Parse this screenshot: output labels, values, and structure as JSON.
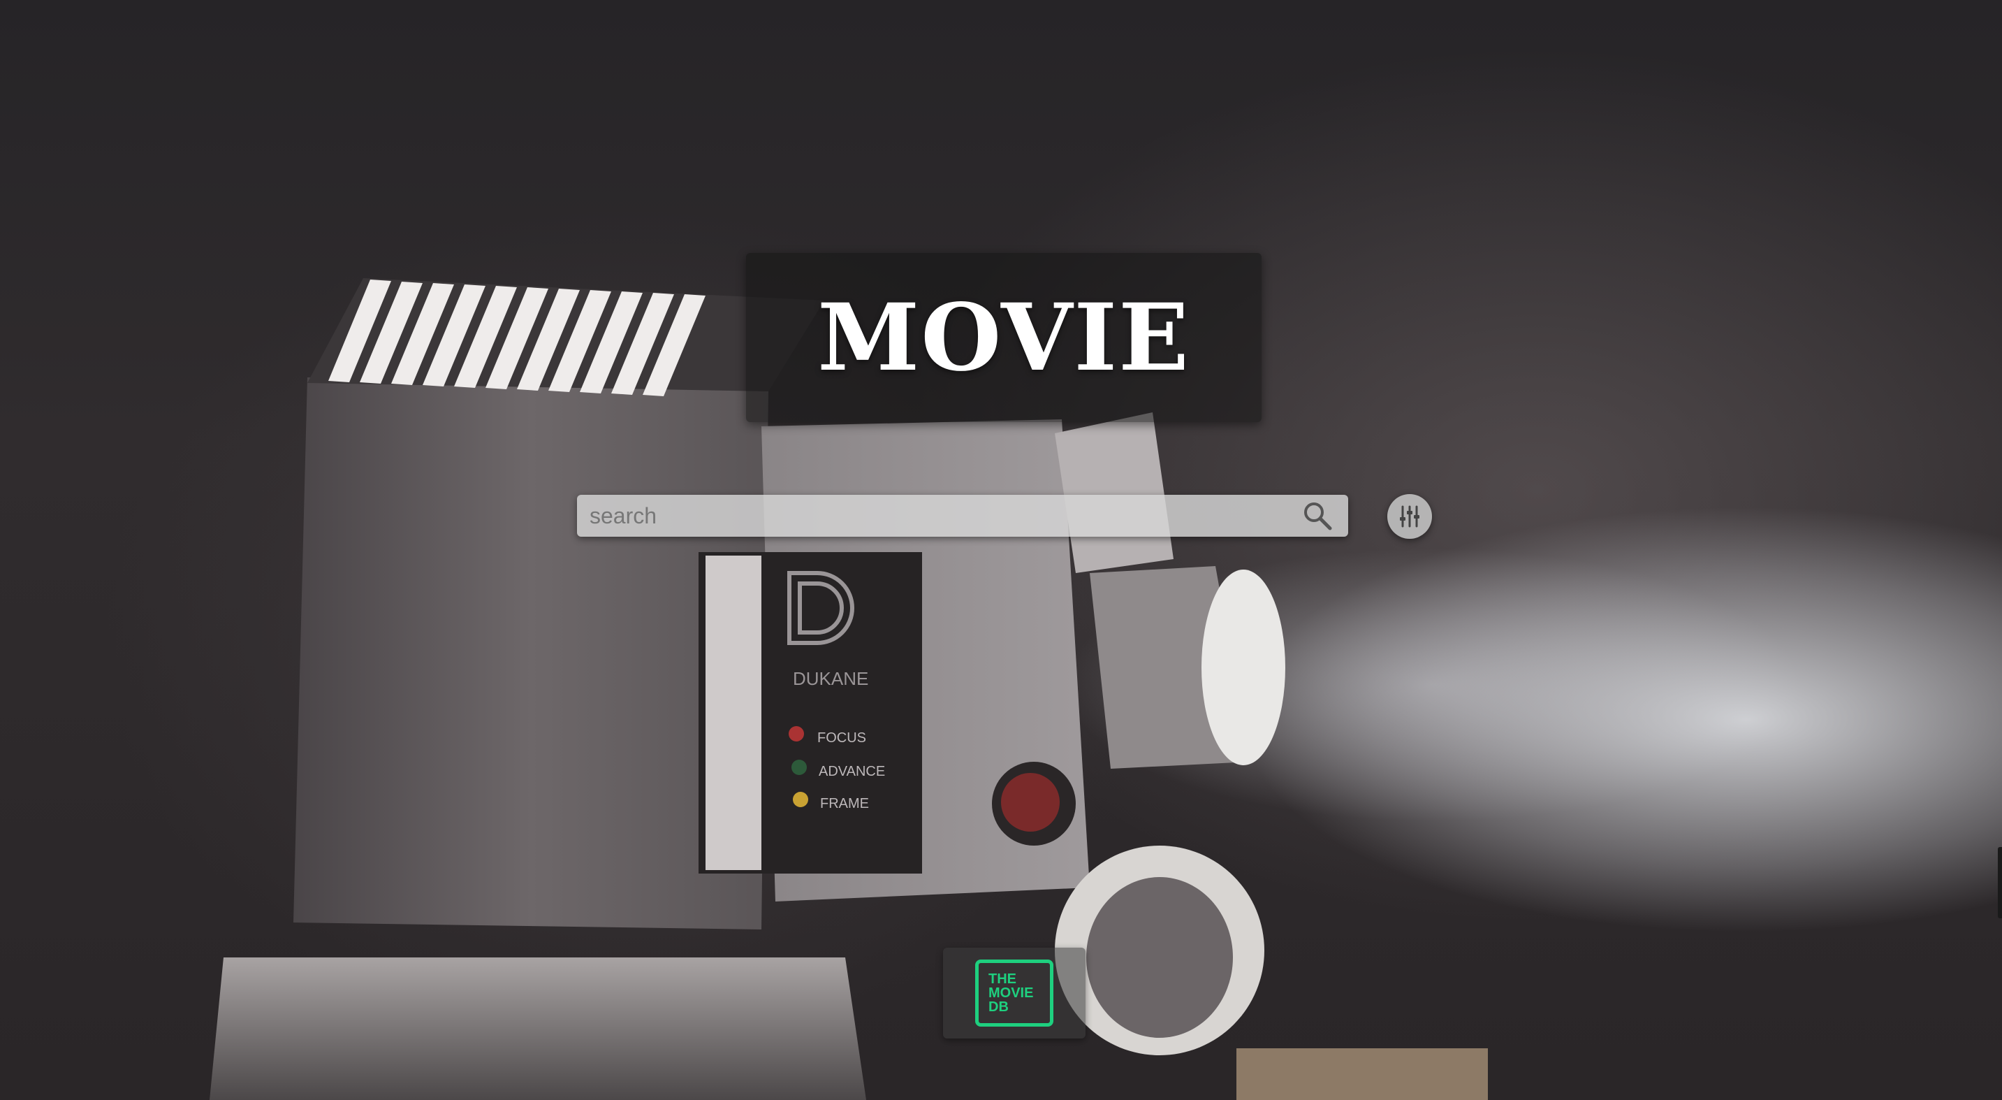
{
  "header": {
    "title": "MOVIE"
  },
  "search": {
    "placeholder": "search",
    "value": ""
  },
  "icons": {
    "search": "search-icon",
    "filter": "sliders-icon",
    "logo": "tmdb-logo"
  },
  "logo": {
    "line1": "THE",
    "line2": "MOVIE",
    "line3": "DB"
  },
  "colors": {
    "brand_green": "#1ed07f",
    "title_text": "#ffffff",
    "search_bg": "#d6d6d6"
  }
}
